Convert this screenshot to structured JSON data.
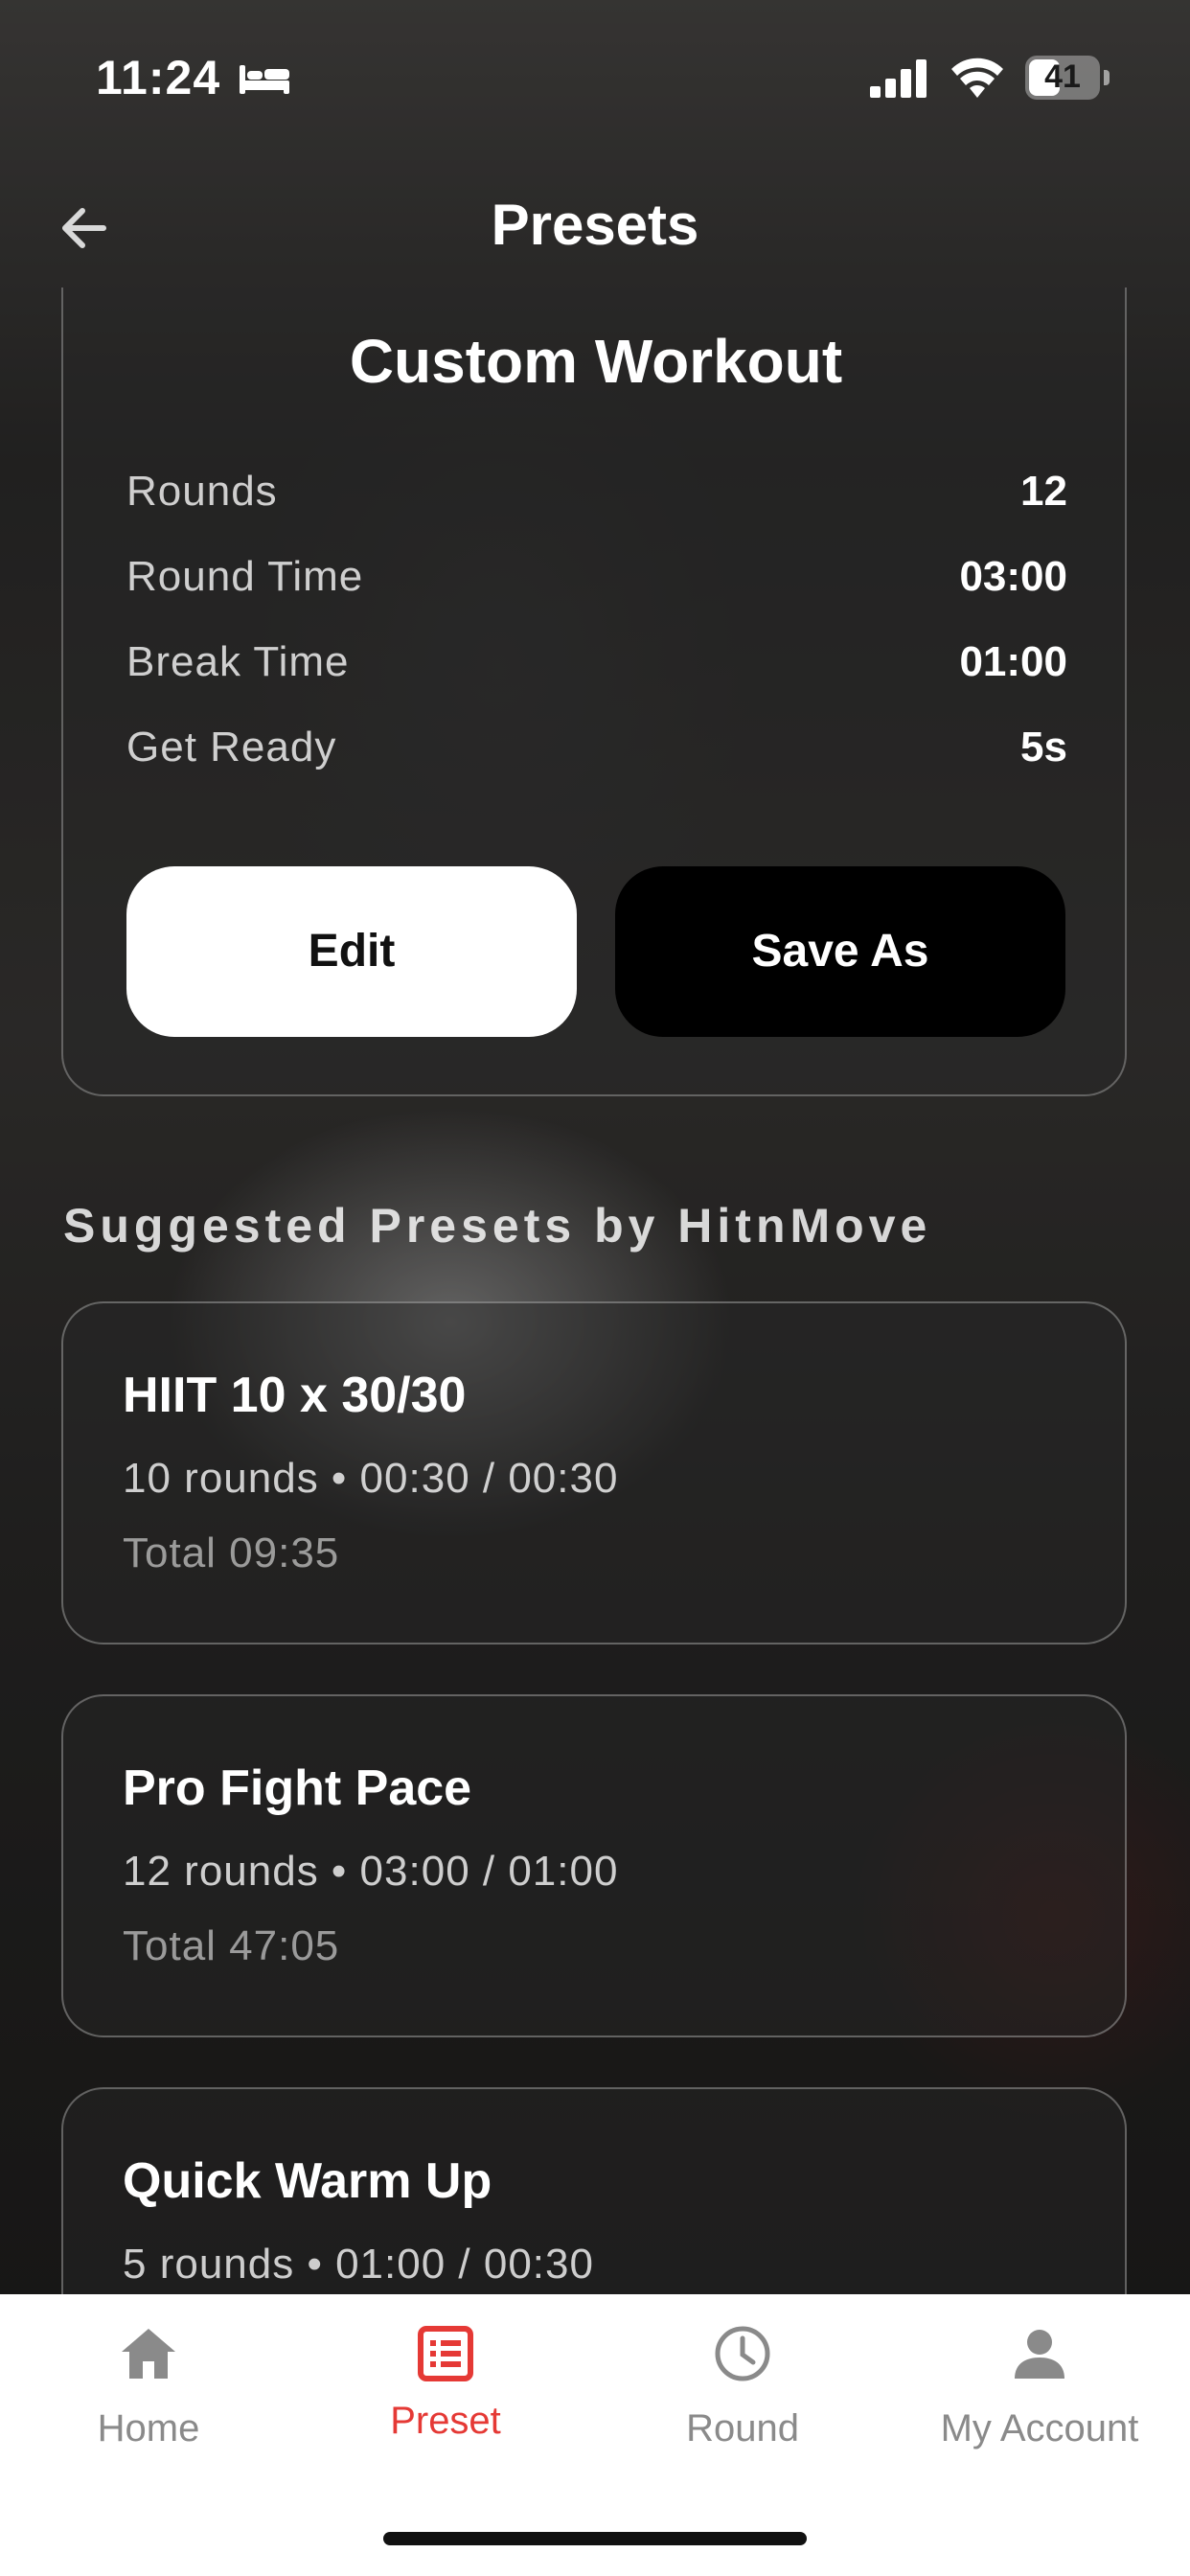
{
  "status_bar": {
    "time": "11:24",
    "battery": "41",
    "icons": [
      "bed-icon",
      "signal-icon",
      "wifi-icon",
      "battery-icon"
    ]
  },
  "header": {
    "title": "Presets",
    "back_icon": "arrow-left-icon"
  },
  "custom_workout": {
    "title": "Custom Workout",
    "stats": [
      {
        "label": "Rounds",
        "value": "12"
      },
      {
        "label": "Round Time",
        "value": "03:00"
      },
      {
        "label": "Break Time",
        "value": "01:00"
      },
      {
        "label": "Get Ready",
        "value": "5s"
      }
    ],
    "edit_label": "Edit",
    "save_as_label": "Save As"
  },
  "suggested": {
    "title": "Suggested Presets by HitnMove",
    "presets": [
      {
        "name": "HIIT 10 x 30/30",
        "detail": "10 rounds • 00:30 / 00:30",
        "total": "Total 09:35"
      },
      {
        "name": "Pro Fight Pace",
        "detail": "12 rounds • 03:00 / 01:00",
        "total": "Total 47:05"
      },
      {
        "name": "Quick Warm Up",
        "detail": "5 rounds • 01:00 / 00:30",
        "total": ""
      }
    ]
  },
  "tabs": [
    {
      "label": "Home",
      "icon": "home-icon",
      "active": false
    },
    {
      "label": "Preset",
      "icon": "list-icon",
      "active": true
    },
    {
      "label": "Round",
      "icon": "clock-icon",
      "active": false
    },
    {
      "label": "My Account",
      "icon": "person-icon",
      "active": false
    }
  ],
  "colors": {
    "accent": "#e53935",
    "inactive": "#8a8a8a"
  }
}
